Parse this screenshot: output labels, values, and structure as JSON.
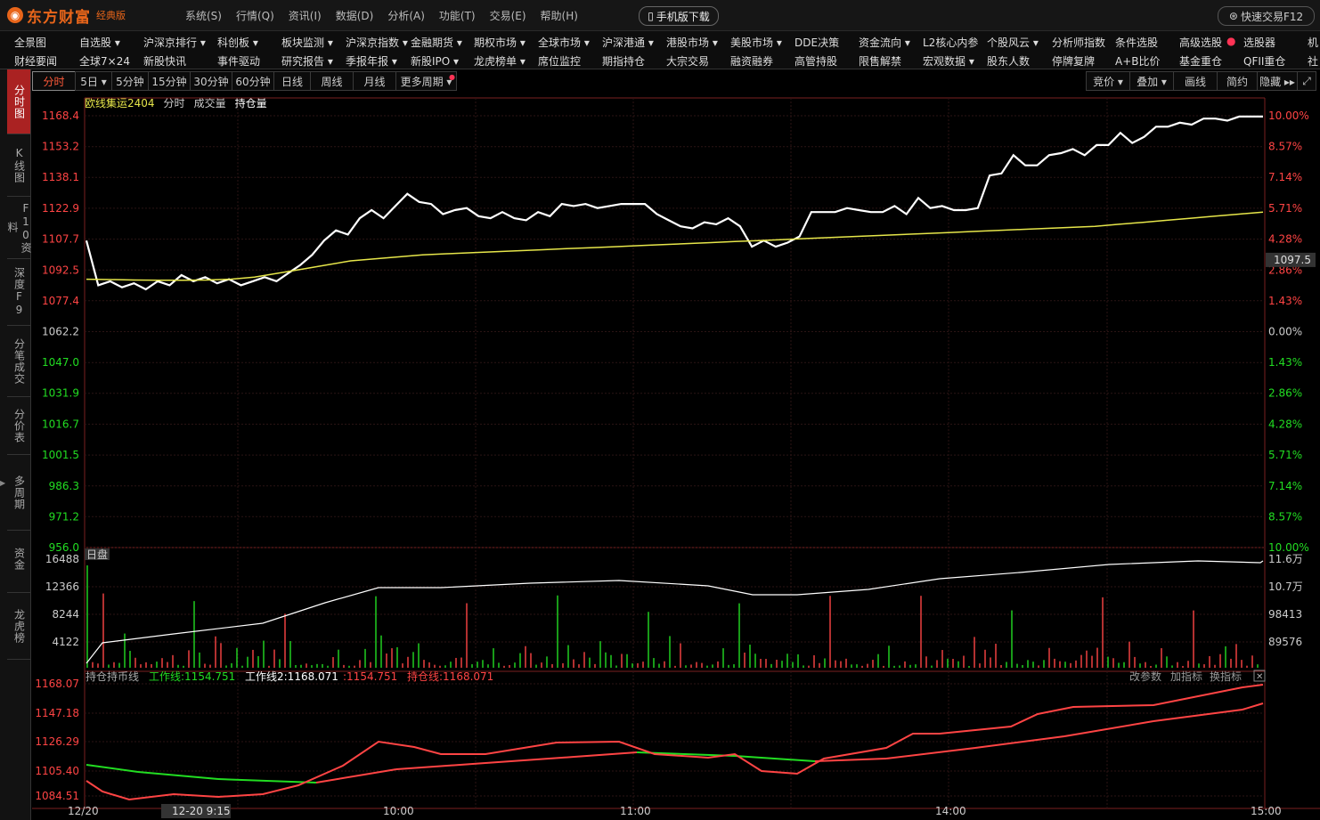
{
  "app": {
    "logo_text": "东方财富",
    "edition": "经典版",
    "menu": [
      "系统(S)",
      "行情(Q)",
      "资讯(I)",
      "数据(D)",
      "分析(A)",
      "功能(T)",
      "交易(E)",
      "帮助(H)"
    ],
    "mobile_download": "手机版下载",
    "quick_trade": "快速交易F12"
  },
  "nav": {
    "row1": [
      "全景图",
      "自选股 ▾",
      "沪深京排行 ▾",
      "科创板 ▾",
      "板块监测 ▾",
      "沪深京指数 ▾",
      "金融期货 ▾",
      "期权市场 ▾",
      "全球市场 ▾",
      "沪深港通 ▾",
      "港股市场 ▾",
      "美股市场 ▾",
      "DDE决策",
      "资金流向 ▾",
      "L2核心内参",
      "个股风云 ▾",
      "分析师指数",
      "条件选股",
      "高级选股",
      "选股器",
      "机"
    ],
    "row2": [
      "财经要闻",
      "全球7×24",
      "新股快讯",
      "事件驱动",
      "研究报告 ▾",
      "季报年报 ▾",
      "新股IPO ▾",
      "龙虎榜单 ▾",
      "席位监控",
      "期指持仓",
      "大宗交易",
      "融资融券",
      "高管持股",
      "限售解禁",
      "宏观数据 ▾",
      "股东人数",
      "停牌复牌",
      "A+B比价",
      "基金重仓",
      "QFII重仓",
      "社"
    ]
  },
  "sidebar": {
    "tabs": [
      "分时图",
      "K线图",
      "F10资料",
      "深度F9",
      "分笔成交",
      "分价表",
      "多周期",
      "资金",
      "龙虎榜"
    ]
  },
  "period_tabs": [
    "分时",
    "5日 ▾",
    "5分钟",
    "15分钟",
    "30分钟",
    "60分钟",
    "日线",
    "周线",
    "月线",
    "更多周期 ▾"
  ],
  "right_tools": [
    "竞价 ▾",
    "叠加 ▾",
    "画线",
    "简约",
    "隐藏 ▸▸"
  ],
  "chart_header": {
    "name": "欧线集运2404",
    "mode": "分时",
    "vol": "成交量",
    "oi": "持仓量"
  },
  "colors": {
    "up": "#ff4444",
    "down": "#22dd22",
    "price_line": "#ffffff",
    "avg_line": "#e6e64a",
    "grid": "#2b1414",
    "accent": "#e8651a"
  },
  "chart_data": [
    {
      "type": "line",
      "name": "intraday-price",
      "y_ticks_left": [
        "1168.4",
        "1153.2",
        "1138.1",
        "1122.9",
        "1107.7",
        "1092.5",
        "1077.4",
        "1062.2",
        "1047.0",
        "1031.9",
        "1016.7",
        "1001.5",
        "986.3",
        "971.2",
        "956.0"
      ],
      "y_ticks_right": [
        "10.00%",
        "8.57%",
        "7.14%",
        "5.71%",
        "4.28%",
        "2.86%",
        "1.43%",
        "0.00%",
        "1.43%",
        "2.86%",
        "4.28%",
        "5.71%",
        "7.14%",
        "8.57%",
        "10.00%"
      ],
      "ylim": [
        956.0,
        1168.4
      ],
      "prev_close": 1062.2,
      "current_price_label": "1097.5",
      "x_ticks": [
        "12/20",
        "12-20 9:15",
        "10:00",
        "11:00",
        "14:00",
        "15:00"
      ],
      "price": [
        1107,
        1085,
        1087,
        1084,
        1086,
        1083,
        1087,
        1085,
        1090,
        1087,
        1089,
        1086,
        1088,
        1085,
        1087,
        1089,
        1087,
        1091,
        1095,
        1100,
        1107,
        1112,
        1110,
        1118,
        1122,
        1118,
        1124,
        1130,
        1126,
        1125,
        1120,
        1122,
        1123,
        1119,
        1118,
        1121,
        1118,
        1117,
        1121,
        1119,
        1125,
        1124,
        1125,
        1123,
        1124,
        1125,
        1125,
        1125,
        1120,
        1117,
        1114,
        1113,
        1116,
        1115,
        1118,
        1114,
        1104,
        1107,
        1104,
        1106,
        1109,
        1121,
        1121,
        1121,
        1123,
        1122,
        1121,
        1121,
        1124,
        1120,
        1128,
        1123,
        1124,
        1122,
        1122,
        1123,
        1139,
        1140,
        1149,
        1144,
        1144,
        1149,
        1150,
        1152,
        1149,
        1154,
        1154,
        1160,
        1155,
        1158,
        1163,
        1163,
        1165,
        1164,
        1167,
        1167,
        1166,
        1168,
        1168,
        1168
      ],
      "avg": [
        1088,
        1087.8,
        1087.6,
        1087.5,
        1087.5,
        1087.6,
        1088,
        1089,
        1091,
        1093,
        1095,
        1097,
        1098,
        1099,
        1100,
        1100.5,
        1101,
        1101.5,
        1102,
        1102.5,
        1103,
        1103.5,
        1104,
        1104.5,
        1105,
        1105.5,
        1106,
        1106.5,
        1107,
        1107.5,
        1108,
        1108.5,
        1109,
        1109.5,
        1110,
        1110.5,
        1111,
        1111.5,
        1112,
        1112.5,
        1113,
        1113.5,
        1114,
        1115,
        1116,
        1117,
        1118,
        1119,
        1120,
        1121
      ],
      "volume_ticks": [
        "16488",
        "12366",
        "8244",
        "4122"
      ],
      "oi_ticks": [
        "11.6万",
        "10.7万",
        "98413",
        "89576"
      ],
      "session_label": "日盘"
    },
    {
      "type": "line",
      "name": "持仓持币线",
      "labels": [
        "持仓持币线",
        "工作线:1154.751",
        "工作线2:1168.071",
        ":1154.751",
        "持仓线:1168.071"
      ],
      "y_ticks": [
        "1168.07",
        "1147.18",
        "1126.29",
        "1105.40",
        "1084.51"
      ],
      "ylim": [
        1084.51,
        1168.07
      ],
      "tools": [
        "改参数",
        "加指标",
        "换指标"
      ]
    }
  ]
}
